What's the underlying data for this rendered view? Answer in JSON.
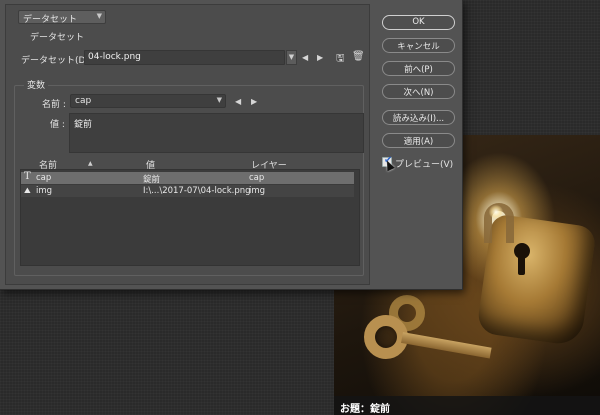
{
  "dialog": {
    "top_dropdown": "データセット",
    "section_dataset": "データセット",
    "dataset_label": "データセット(D) :",
    "dataset_value": "04-lock.png",
    "section_variables": "変数",
    "name_label": "名前 :",
    "name_value": "cap",
    "value_label": "値 :",
    "value_text": "錠前"
  },
  "table": {
    "headers": [
      "名前",
      "値",
      "レイヤー"
    ],
    "rows": [
      {
        "name": "cap",
        "value": "錠前",
        "layer": "cap",
        "type_icon": "text-layer-icon"
      },
      {
        "name": "img",
        "value": "I:\\...\\2017-07\\04-lock.png",
        "layer": "img",
        "type_icon": "image-layer-icon"
      }
    ]
  },
  "buttons": {
    "ok": "OK",
    "cancel": "キャンセル",
    "prev": "前へ(P)",
    "next": "次へ(N)",
    "import": "読み込み(I)...",
    "apply": "適用(A)",
    "preview": "プレビュー(V)"
  },
  "preview_checked": true,
  "photo": {
    "caption": "お題：錠前"
  },
  "icons": {
    "dropdown": "chevron-down-icon",
    "prev": "triangle-left-icon",
    "next": "triangle-right-icon",
    "save": "save-dataset-icon",
    "delete": "trash-icon",
    "text_layer": "text-layer-icon",
    "image_layer": "image-layer-icon"
  },
  "colors": {
    "dialog_bg": "#535353",
    "panel_bg": "#4c4c4c",
    "field_bg": "#3f3f3f",
    "selected_row": "#6e6e6e",
    "checkbox_tick": "#2a62c8"
  }
}
